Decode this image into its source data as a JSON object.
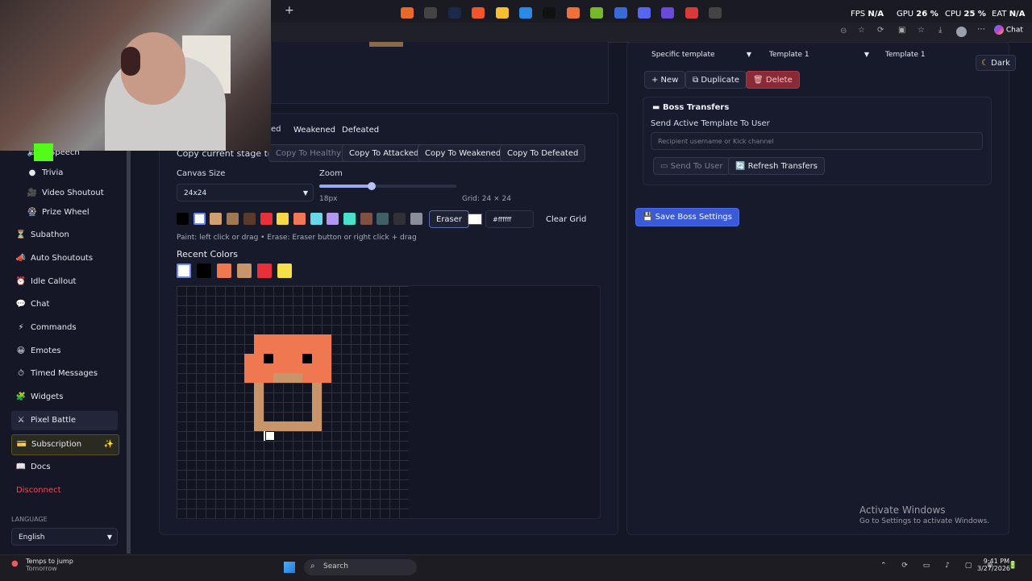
{
  "browser": {
    "stats": {
      "fps_label": "FPS",
      "fps_value": "N/A",
      "gpu_label": "GPU",
      "gpu_value": "26 %",
      "cpu_label": "CPU",
      "cpu_value": "25 %",
      "eat_label": "EAT",
      "eat_value": "N/A"
    },
    "new_tab": "+",
    "chat_label": "Chat"
  },
  "sidebar": {
    "items": [
      {
        "icon": "🔊",
        "label": "o-Speech"
      },
      {
        "icon": "●",
        "label": "Trivia"
      },
      {
        "icon": "🎥",
        "label": "Video Shoutout"
      },
      {
        "icon": "🎡",
        "label": "Prize Wheel"
      },
      {
        "icon": "⏳",
        "label": "Subathon"
      },
      {
        "icon": "📣",
        "label": "Auto Shoutouts"
      },
      {
        "icon": "⏰",
        "label": "Idle Callout"
      },
      {
        "icon": "💬",
        "label": "Chat"
      },
      {
        "icon": "⚡",
        "label": "Commands"
      },
      {
        "icon": "😀",
        "label": "Emotes"
      },
      {
        "icon": "⏱",
        "label": "Timed Messages"
      },
      {
        "icon": "🧩",
        "label": "Widgets"
      },
      {
        "icon": "⚔",
        "label": "Pixel Battle"
      },
      {
        "icon": "💳",
        "label": "Subscription"
      },
      {
        "icon": "📖",
        "label": "Docs"
      }
    ],
    "subscription_badge": "✨",
    "disconnect": "Disconnect",
    "language_label": "LANGUAGE",
    "language_value": "English"
  },
  "editor": {
    "stage_tabs": [
      "ed",
      "Weakened",
      "Defeated"
    ],
    "copy_label": "Copy current stage to:",
    "copy_buttons": [
      "Copy To Healthy",
      "Copy To Attacked",
      "Copy To Weakened",
      "Copy To Defeated"
    ],
    "canvas_size_label": "Canvas Size",
    "canvas_size_value": "24x24",
    "zoom_label": "Zoom",
    "zoom_value": "18px",
    "zoom_fraction": 0.38,
    "grid_label": "Grid: 24 × 24",
    "palette": [
      "#000000",
      "#ffffff",
      "#d0a070",
      "#a07850",
      "#5a3a2a",
      "#e8303a",
      "#f8d848",
      "#f07858",
      "#68d8e8",
      "#b098f0",
      "#48e0c8",
      "#805040",
      "#406068",
      "#303038",
      "#8a8e98"
    ],
    "eraser_label": "Eraser",
    "hex_value": "#ffffff",
    "clear_grid": "Clear Grid",
    "hint": "Paint: left click or drag • Erase: Eraser button or right click + drag",
    "recent_colors_label": "Recent Colors",
    "recent_colors": [
      "#ffffff",
      "#000000",
      "#f07850",
      "#c8946a",
      "#e8303a",
      "#f8e048"
    ],
    "pixel_colors": {
      "orange": "#f07850",
      "black": "#000000",
      "tan": "#c8946a",
      "white": "#ffffff"
    }
  },
  "right": {
    "template_mode": "Specific template",
    "template_select": "Template 1",
    "template_name": "Template 1",
    "dark_toggle": "Dark",
    "new_button": "+ New",
    "duplicate_button": "Duplicate",
    "delete_button": "Delete",
    "boss_transfers_title": "Boss Transfers",
    "send_label": "Send Active Template To User",
    "recipient_placeholder": "Recipient username or Kick channel",
    "send_button": "Send To User",
    "refresh_button": "Refresh Transfers",
    "save_button": "Save Boss Settings"
  },
  "watermark": {
    "title": "Activate Windows",
    "subtitle": "Go to Settings to activate Windows."
  },
  "taskbar": {
    "weather_title": "Temps to jump",
    "weather_sub": "Tomorrow",
    "search": "Search",
    "time": "9:41 PM",
    "date": "3/27/2026"
  }
}
